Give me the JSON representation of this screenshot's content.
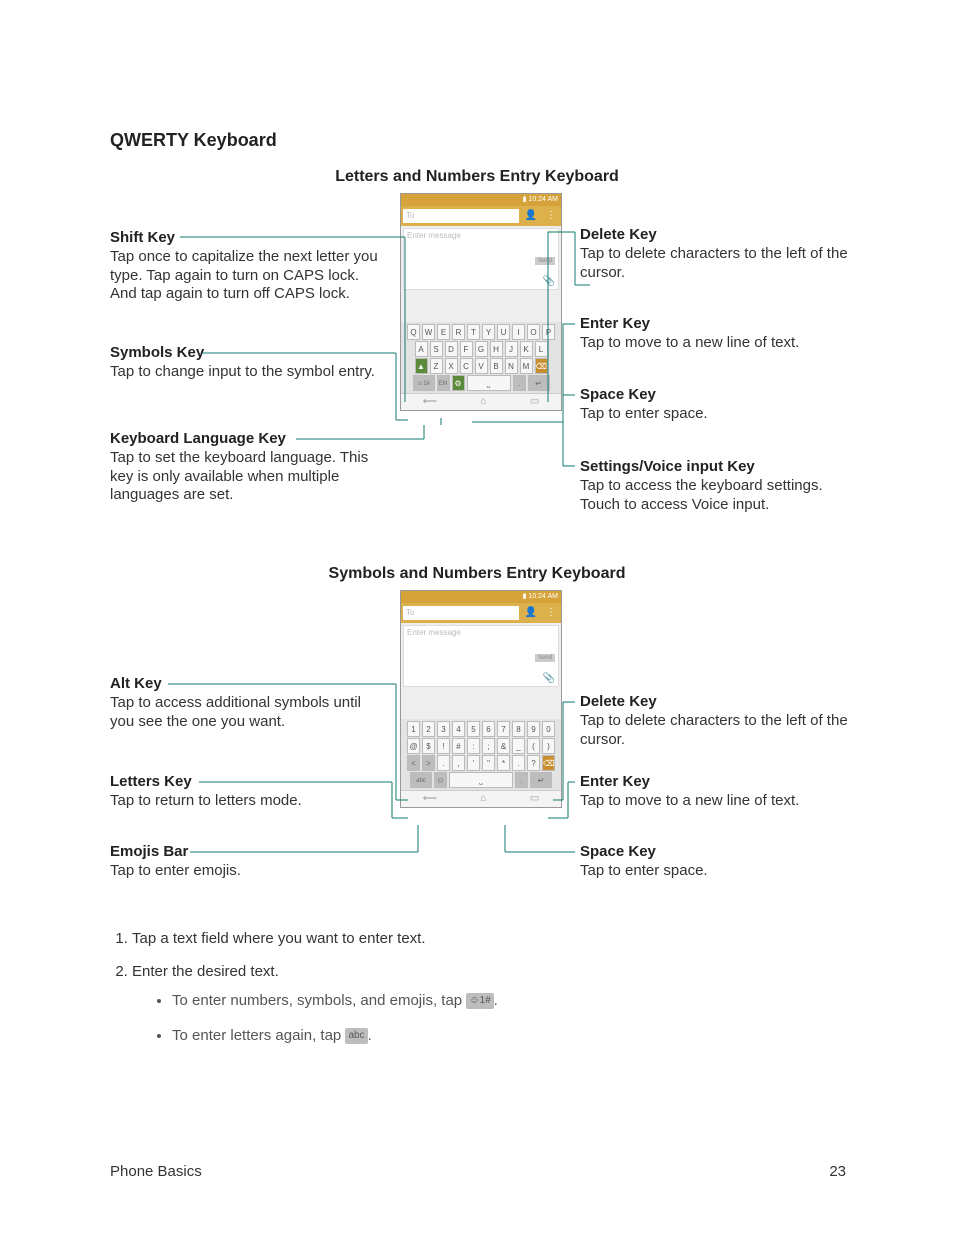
{
  "heading": "QWERTY Keyboard",
  "diagram1": {
    "title": "Letters and Numbers Entry Keyboard",
    "left": {
      "shift": {
        "label": "Shift Key",
        "desc": "Tap once to capitalize the next letter you type. Tap again to turn on CAPS lock. And tap again to turn off CAPS lock."
      },
      "symbols": {
        "label": "Symbols Key",
        "desc": "Tap to change input to the symbol entry."
      },
      "lang": {
        "label": "Keyboard Language Key",
        "desc": "Tap to set the keyboard language. This key is only available when multiple languages are set."
      }
    },
    "right": {
      "delete": {
        "label": "Delete Key",
        "desc": "Tap to delete characters to the left of the cursor."
      },
      "enter": {
        "label": "Enter Key",
        "desc": "Tap to move to a new line of text."
      },
      "space": {
        "label": "Space Key",
        "desc": "Tap to enter space."
      },
      "settings": {
        "label": "Settings/Voice input Key",
        "desc": "Tap to access the keyboard settings. Touch to access Voice input."
      }
    }
  },
  "diagram2": {
    "title": "Symbols and Numbers Entry Keyboard",
    "left": {
      "alt": {
        "label": "Alt Key",
        "desc": "Tap to access additional symbols until you see the one you want."
      },
      "letters": {
        "label": "Letters Key",
        "desc": "Tap to return to letters mode."
      },
      "emojis": {
        "label": "Emojis Bar",
        "desc": "Tap to enter emojis."
      }
    },
    "right": {
      "delete": {
        "label": "Delete Key",
        "desc": "Tap to delete characters to the left of the cursor."
      },
      "enter": {
        "label": "Enter Key",
        "desc": "Tap to move to a new line of text."
      },
      "space": {
        "label": "Space Key",
        "desc": "Tap to enter space."
      }
    }
  },
  "phone": {
    "status_time": "10:24 AM",
    "to_placeholder": "To",
    "msg_placeholder": "Enter message",
    "send_label": "Send",
    "row1": [
      "Q",
      "W",
      "E",
      "R",
      "T",
      "Y",
      "U",
      "I",
      "O",
      "P"
    ],
    "row2": [
      "A",
      "S",
      "D",
      "F",
      "G",
      "H",
      "J",
      "K",
      "L"
    ],
    "row3": [
      "Z",
      "X",
      "C",
      "V",
      "B",
      "N",
      "M"
    ],
    "shift_glyph": "▲",
    "del_glyph": "⌫",
    "sym_key": "☺1#",
    "lang_key": "EN",
    "gear_glyph": "⚙",
    "space_glyph": "⎵",
    "dot_key": ".",
    "enter_glyph": "↵",
    "nav_back": "⟵",
    "nav_home": "⌂",
    "nav_recent": "▭",
    "sym_row1": [
      "1",
      "2",
      "3",
      "4",
      "5",
      "6",
      "7",
      "8",
      "9",
      "0"
    ],
    "sym_row2": [
      "@",
      "$",
      "!",
      "#",
      ":",
      ";",
      "&",
      "_",
      "(",
      ")"
    ],
    "sym_row3_alt_l": "<",
    "sym_row3_alt_r": ">",
    "sym_row3": [
      ".",
      ",",
      "'",
      "\"",
      "*",
      ".",
      "?"
    ],
    "abc_key": "abc",
    "emoji_key": "☺"
  },
  "instructions": {
    "step1": "Tap a text field where you want to enter text.",
    "step2": "Enter the desired text.",
    "sub1_before": "To enter numbers, symbols, and emojis, tap ",
    "sub1_key": "☺1#",
    "sub1_after": ".",
    "sub2_before": "To enter letters again, tap ",
    "sub2_key": "abc",
    "sub2_after": "."
  },
  "footer": {
    "section": "Phone Basics",
    "page": "23"
  }
}
